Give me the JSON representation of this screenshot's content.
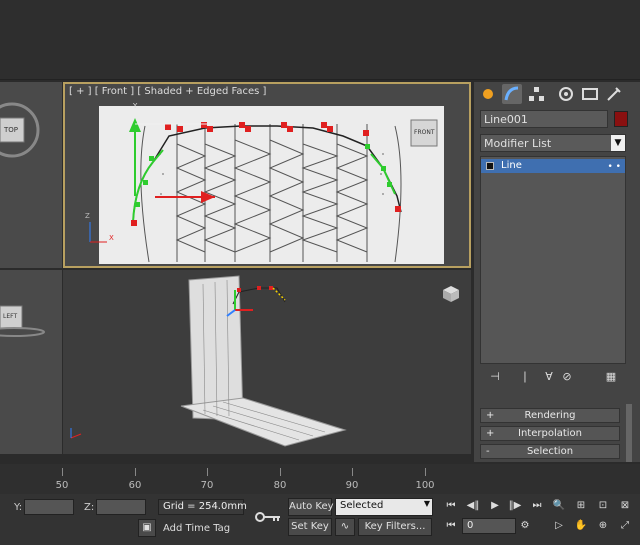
{
  "viewports": {
    "front_label": "[ + ] [ Front ] [ Shaded + Edged Faces ]",
    "top_cube": "TOP",
    "front_cube": "FRONT",
    "left_cube": "LEFT",
    "axis_y": "Y",
    "axis_z": "Z",
    "axis_x": "X"
  },
  "panel": {
    "object_name": "Line001",
    "modifier_list": "Modifier List",
    "modifier_arrow": "▼",
    "stack_item": "Line",
    "stack_dots": "• •",
    "rollouts": [
      {
        "sign": "+",
        "label": "Rendering"
      },
      {
        "sign": "+",
        "label": "Interpolation"
      },
      {
        "sign": "-",
        "label": "Selection"
      }
    ],
    "colors": {
      "object_color": "#8a1010",
      "stack_selected": "#3f6fb0",
      "active_border": "#b8a060"
    }
  },
  "timeline": {
    "ticks": [
      "50",
      "60",
      "70",
      "80",
      "90",
      "100"
    ]
  },
  "status": {
    "y_label": "Y:",
    "z_label": "Z:",
    "grid": "Grid = 254.0mm",
    "auto_key": "Auto Key",
    "set_key": "Set Key",
    "selected": "Selected",
    "key_filters": "Key Filters...",
    "add_time_tag": "Add Time Tag",
    "frame": "0"
  }
}
